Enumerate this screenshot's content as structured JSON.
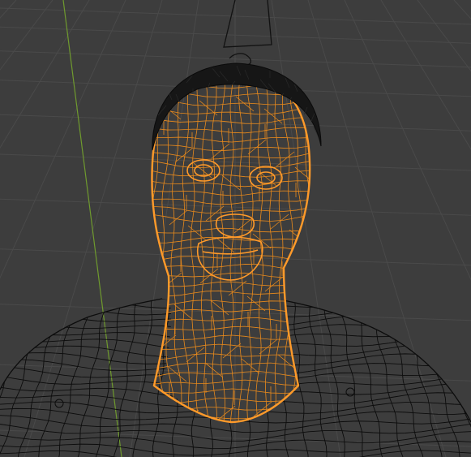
{
  "viewport": {
    "view": "3d-viewport",
    "shading_mode": "wireframe",
    "background_color": "#3d3d3d",
    "grid_line_color": "#4a4a4a",
    "y_axis_color": "#6f9a2e"
  },
  "scene": {
    "objects": [
      {
        "name": "head",
        "selected": true,
        "selection_color": "#ff9a2a",
        "wire_color": "#e98a1c"
      },
      {
        "name": "hair",
        "selected": false,
        "wire_color": "#111111"
      },
      {
        "name": "body",
        "selected": false,
        "wire_color": "#0c0c0c"
      },
      {
        "name": "camera-rig",
        "selected": false,
        "wire_color": "#111111"
      }
    ]
  }
}
